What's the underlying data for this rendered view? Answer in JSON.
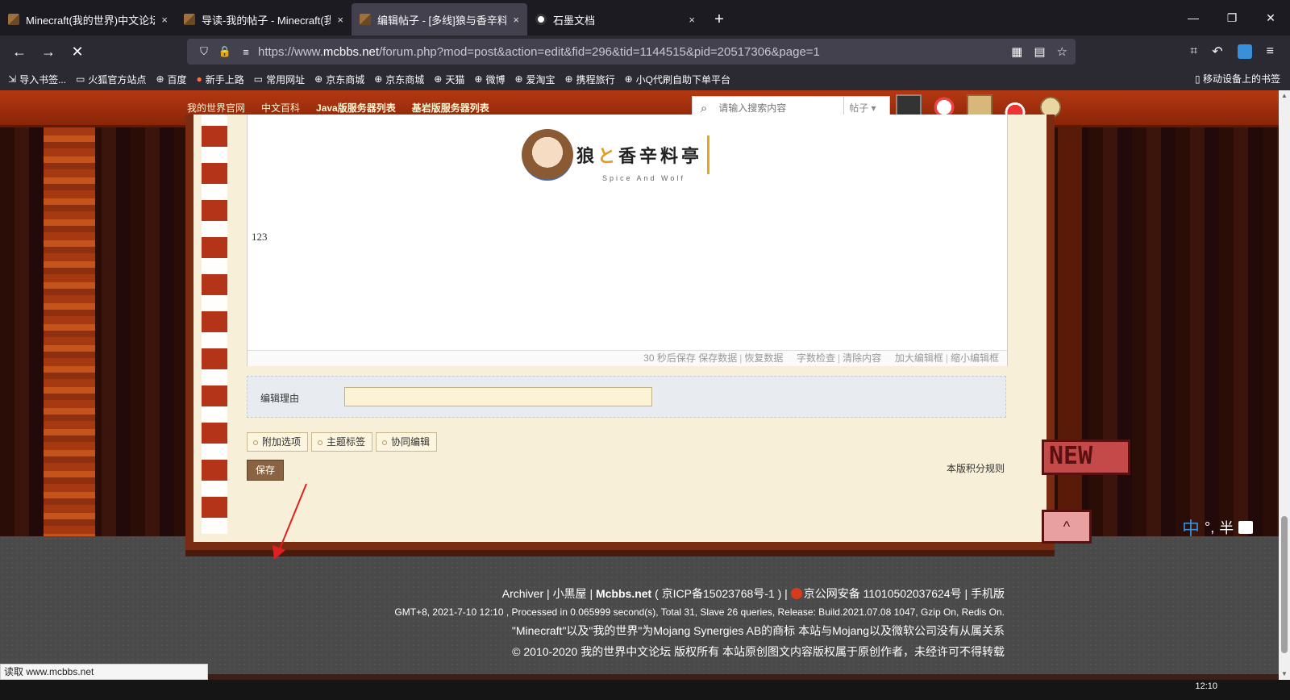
{
  "browser": {
    "tabs": [
      {
        "title": "Minecraft(我的世界)中文论坛-",
        "close": "×"
      },
      {
        "title": "导读-我的帖子 - Minecraft(我的",
        "close": "×"
      },
      {
        "title": "编辑帖子 - [多线]狼与香辛料亭",
        "close": "×"
      },
      {
        "title": "石墨文档",
        "close": "×"
      }
    ],
    "new_tab": "+",
    "window_controls": {
      "minimize": "—",
      "maximize": "❐",
      "close": "✕"
    },
    "url": {
      "prefix": "https://www.",
      "domain": "mcbbs.net",
      "path": "/forum.php?mod=post&action=edit&fid=296&tid=1144515&pid=20517306&page=1"
    },
    "nav": {
      "back": "←",
      "forward": "→",
      "stop": "✕"
    },
    "bookmarks": [
      {
        "icon": "⇲",
        "label": "导入书签..."
      },
      {
        "icon": "▭",
        "label": "火狐官方站点"
      },
      {
        "icon": "⊕",
        "label": "百度"
      },
      {
        "icon": "●",
        "label": "新手上路"
      },
      {
        "icon": "▭",
        "label": "常用网址"
      },
      {
        "icon": "⊕",
        "label": "京东商城"
      },
      {
        "icon": "⊕",
        "label": "京东商城"
      },
      {
        "icon": "⊕",
        "label": "天猫"
      },
      {
        "icon": "⊕",
        "label": "微博"
      },
      {
        "icon": "⊕",
        "label": "爱淘宝"
      },
      {
        "icon": "⊕",
        "label": "携程旅行"
      },
      {
        "icon": "⊕",
        "label": "小Q代刷自助下单平台"
      }
    ],
    "mobile_bookmarks": "移动设备上的书签"
  },
  "site_header": {
    "links": [
      "我的世界官网",
      "中文百科",
      "Java版服务器列表",
      "基岩版服务器列表"
    ],
    "search_placeholder": "请输入搜索内容",
    "search_type": "帖子"
  },
  "editor": {
    "logo_text": {
      "wolf": "狼",
      "to": "と",
      "rest": "香辛料亭"
    },
    "logo_sub": "Spice And Wolf",
    "content": "123",
    "footer_autosave": "30 秒后保存",
    "footer_links": [
      "保存数据",
      "恢复数据",
      "字数检查",
      "清除内容",
      "加大编辑框",
      "缩小编辑框"
    ]
  },
  "edit_reason_label": "编辑理由",
  "options": [
    "附加选项",
    "主题标签",
    "协同编辑"
  ],
  "save_button": "保存",
  "rules_link": "本版积分规则",
  "side_flags": {
    "new": "NEW",
    "top": "^"
  },
  "footer": {
    "links": [
      "Archiver",
      "小黑屋"
    ],
    "brand": "Mcbbs.net",
    "icp": "( 京ICP备15023768号-1 )",
    "police": "京公网安备 11010502037624号",
    "mobile": "手机版",
    "stats": "GMT+8, 2021-7-10 12:10 , Processed in 0.065999 second(s), Total 31, Slave 26 queries, Release: Build.2021.07.08 1047, Gzip On, Redis On.",
    "trademark": "\"Minecraft\"以及\"我的世界\"为Mojang Synergies AB的商标 本站与Mojang以及微软公司没有从属关系",
    "copyright": "© 2010-2020 我的世界中文论坛 版权所有 本站原创图文内容版权属于原创作者，未经许可不得转载"
  },
  "ime": {
    "lang": "中",
    "punct": "°,",
    "width": "半"
  },
  "status_bar": "读取 www.mcbbs.net",
  "clock": "12:10"
}
